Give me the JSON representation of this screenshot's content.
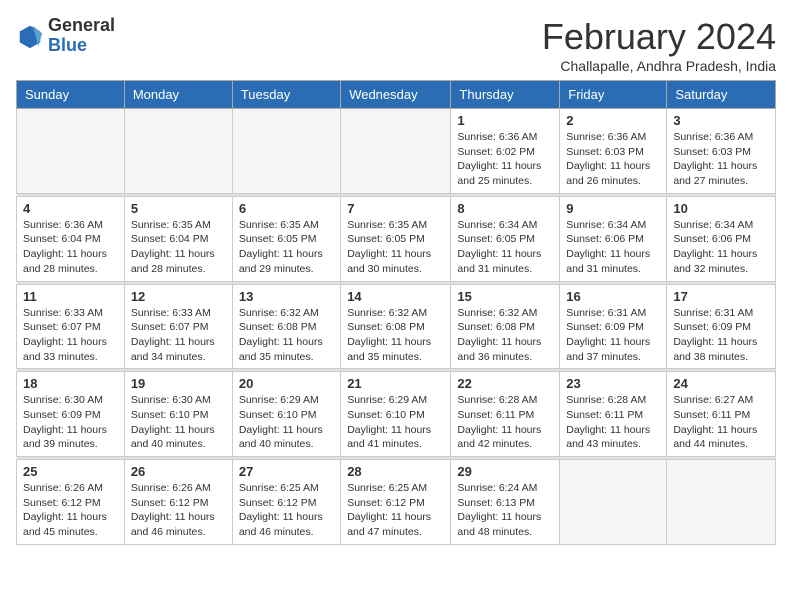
{
  "logo": {
    "general": "General",
    "blue": "Blue"
  },
  "header": {
    "title": "February 2024",
    "subtitle": "Challapalle, Andhra Pradesh, India"
  },
  "days_of_week": [
    "Sunday",
    "Monday",
    "Tuesday",
    "Wednesday",
    "Thursday",
    "Friday",
    "Saturday"
  ],
  "weeks": [
    [
      {
        "day": "",
        "empty": true
      },
      {
        "day": "",
        "empty": true
      },
      {
        "day": "",
        "empty": true
      },
      {
        "day": "",
        "empty": true
      },
      {
        "day": "1",
        "sunrise": "6:36 AM",
        "sunset": "6:02 PM",
        "daylight": "11 hours and 25 minutes."
      },
      {
        "day": "2",
        "sunrise": "6:36 AM",
        "sunset": "6:03 PM",
        "daylight": "11 hours and 26 minutes."
      },
      {
        "day": "3",
        "sunrise": "6:36 AM",
        "sunset": "6:03 PM",
        "daylight": "11 hours and 27 minutes."
      }
    ],
    [
      {
        "day": "4",
        "sunrise": "6:36 AM",
        "sunset": "6:04 PM",
        "daylight": "11 hours and 28 minutes."
      },
      {
        "day": "5",
        "sunrise": "6:35 AM",
        "sunset": "6:04 PM",
        "daylight": "11 hours and 28 minutes."
      },
      {
        "day": "6",
        "sunrise": "6:35 AM",
        "sunset": "6:05 PM",
        "daylight": "11 hours and 29 minutes."
      },
      {
        "day": "7",
        "sunrise": "6:35 AM",
        "sunset": "6:05 PM",
        "daylight": "11 hours and 30 minutes."
      },
      {
        "day": "8",
        "sunrise": "6:34 AM",
        "sunset": "6:05 PM",
        "daylight": "11 hours and 31 minutes."
      },
      {
        "day": "9",
        "sunrise": "6:34 AM",
        "sunset": "6:06 PM",
        "daylight": "11 hours and 31 minutes."
      },
      {
        "day": "10",
        "sunrise": "6:34 AM",
        "sunset": "6:06 PM",
        "daylight": "11 hours and 32 minutes."
      }
    ],
    [
      {
        "day": "11",
        "sunrise": "6:33 AM",
        "sunset": "6:07 PM",
        "daylight": "11 hours and 33 minutes."
      },
      {
        "day": "12",
        "sunrise": "6:33 AM",
        "sunset": "6:07 PM",
        "daylight": "11 hours and 34 minutes."
      },
      {
        "day": "13",
        "sunrise": "6:32 AM",
        "sunset": "6:08 PM",
        "daylight": "11 hours and 35 minutes."
      },
      {
        "day": "14",
        "sunrise": "6:32 AM",
        "sunset": "6:08 PM",
        "daylight": "11 hours and 35 minutes."
      },
      {
        "day": "15",
        "sunrise": "6:32 AM",
        "sunset": "6:08 PM",
        "daylight": "11 hours and 36 minutes."
      },
      {
        "day": "16",
        "sunrise": "6:31 AM",
        "sunset": "6:09 PM",
        "daylight": "11 hours and 37 minutes."
      },
      {
        "day": "17",
        "sunrise": "6:31 AM",
        "sunset": "6:09 PM",
        "daylight": "11 hours and 38 minutes."
      }
    ],
    [
      {
        "day": "18",
        "sunrise": "6:30 AM",
        "sunset": "6:09 PM",
        "daylight": "11 hours and 39 minutes."
      },
      {
        "day": "19",
        "sunrise": "6:30 AM",
        "sunset": "6:10 PM",
        "daylight": "11 hours and 40 minutes."
      },
      {
        "day": "20",
        "sunrise": "6:29 AM",
        "sunset": "6:10 PM",
        "daylight": "11 hours and 40 minutes."
      },
      {
        "day": "21",
        "sunrise": "6:29 AM",
        "sunset": "6:10 PM",
        "daylight": "11 hours and 41 minutes."
      },
      {
        "day": "22",
        "sunrise": "6:28 AM",
        "sunset": "6:11 PM",
        "daylight": "11 hours and 42 minutes."
      },
      {
        "day": "23",
        "sunrise": "6:28 AM",
        "sunset": "6:11 PM",
        "daylight": "11 hours and 43 minutes."
      },
      {
        "day": "24",
        "sunrise": "6:27 AM",
        "sunset": "6:11 PM",
        "daylight": "11 hours and 44 minutes."
      }
    ],
    [
      {
        "day": "25",
        "sunrise": "6:26 AM",
        "sunset": "6:12 PM",
        "daylight": "11 hours and 45 minutes."
      },
      {
        "day": "26",
        "sunrise": "6:26 AM",
        "sunset": "6:12 PM",
        "daylight": "11 hours and 46 minutes."
      },
      {
        "day": "27",
        "sunrise": "6:25 AM",
        "sunset": "6:12 PM",
        "daylight": "11 hours and 46 minutes."
      },
      {
        "day": "28",
        "sunrise": "6:25 AM",
        "sunset": "6:12 PM",
        "daylight": "11 hours and 47 minutes."
      },
      {
        "day": "29",
        "sunrise": "6:24 AM",
        "sunset": "6:13 PM",
        "daylight": "11 hours and 48 minutes."
      },
      {
        "day": "",
        "empty": true
      },
      {
        "day": "",
        "empty": true
      }
    ]
  ]
}
